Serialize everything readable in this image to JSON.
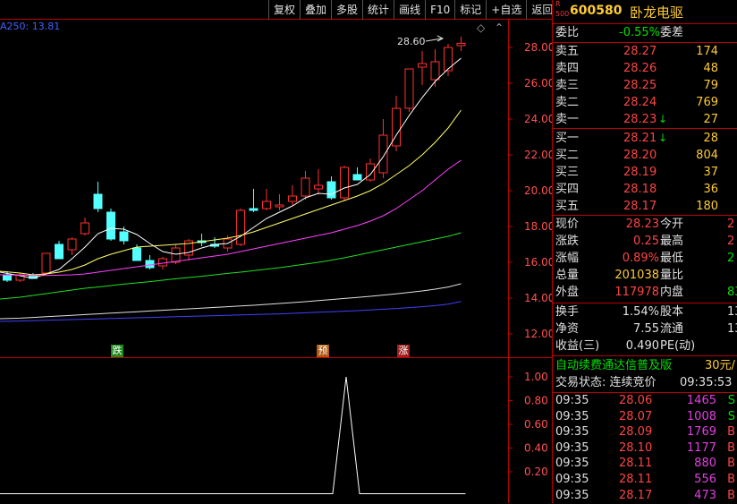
{
  "toolbar": [
    "复权",
    "叠加",
    "多股",
    "统计",
    "画线",
    "F10",
    "标记",
    "+自选",
    "返回"
  ],
  "ma_label": "A250: 13.81",
  "peak_label": "28.60",
  "markers": [
    {
      "text": "跌",
      "bg": "#1e8a1e",
      "color": "#fff"
    },
    {
      "text": "预",
      "bg": "#b05a10",
      "color": "#fff"
    },
    {
      "text": "涨",
      "bg": "#a02020",
      "color": "#fff"
    }
  ],
  "price_ticks": [
    "28.00",
    "26.00",
    "24.00",
    "22.00",
    "20.00",
    "18.00",
    "16.00",
    "14.00",
    "12.00"
  ],
  "ind_ticks": [
    "1.00",
    "0.80",
    "0.60",
    "0.40",
    "0.20"
  ],
  "chart_data": {
    "type": "candlestick",
    "ylim": [
      11.2,
      29.0
    ],
    "candles": [
      {
        "o": 15.3,
        "h": 15.5,
        "l": 14.9,
        "c": 15.0,
        "up": false
      },
      {
        "o": 15.0,
        "h": 15.4,
        "l": 14.9,
        "c": 15.3,
        "up": true
      },
      {
        "o": 15.3,
        "h": 15.4,
        "l": 15.1,
        "c": 15.1,
        "up": false
      },
      {
        "o": 15.4,
        "h": 16.3,
        "l": 15.3,
        "c": 16.5,
        "up": true
      },
      {
        "o": 17.0,
        "h": 17.2,
        "l": 16.2,
        "c": 16.2,
        "up": false
      },
      {
        "o": 16.7,
        "h": 17.4,
        "l": 16.4,
        "c": 17.3,
        "up": true
      },
      {
        "o": 17.6,
        "h": 18.5,
        "l": 17.5,
        "c": 18.2,
        "up": true
      },
      {
        "o": 19.8,
        "h": 20.5,
        "l": 18.8,
        "c": 19.0,
        "up": false
      },
      {
        "o": 18.8,
        "h": 19.0,
        "l": 17.2,
        "c": 17.3,
        "up": false
      },
      {
        "o": 17.7,
        "h": 18.0,
        "l": 17.0,
        "c": 17.2,
        "up": false
      },
      {
        "o": 16.8,
        "h": 17.0,
        "l": 16.1,
        "c": 16.1,
        "up": false
      },
      {
        "o": 16.1,
        "h": 16.4,
        "l": 15.6,
        "c": 15.7,
        "up": false
      },
      {
        "o": 15.8,
        "h": 16.3,
        "l": 15.6,
        "c": 16.2,
        "up": true
      },
      {
        "o": 16.0,
        "h": 17.0,
        "l": 15.9,
        "c": 16.8,
        "up": true
      },
      {
        "o": 16.4,
        "h": 17.3,
        "l": 16.1,
        "c": 17.2,
        "up": true
      },
      {
        "o": 17.2,
        "h": 17.6,
        "l": 16.9,
        "c": 17.1,
        "up": false
      },
      {
        "o": 17.0,
        "h": 17.4,
        "l": 16.8,
        "c": 16.9,
        "up": false
      },
      {
        "o": 16.8,
        "h": 17.5,
        "l": 16.6,
        "c": 17.3,
        "up": true
      },
      {
        "o": 17.0,
        "h": 19.0,
        "l": 16.9,
        "c": 18.9,
        "up": true
      },
      {
        "o": 19.0,
        "h": 20.1,
        "l": 18.8,
        "c": 18.9,
        "up": false
      },
      {
        "o": 19.0,
        "h": 20.1,
        "l": 18.9,
        "c": 19.4,
        "up": true
      },
      {
        "o": 19.1,
        "h": 19.8,
        "l": 18.9,
        "c": 19.2,
        "up": true
      },
      {
        "o": 19.4,
        "h": 20.3,
        "l": 19.2,
        "c": 19.7,
        "up": true
      },
      {
        "o": 19.7,
        "h": 21.1,
        "l": 19.5,
        "c": 20.7,
        "up": true
      },
      {
        "o": 20.3,
        "h": 21.2,
        "l": 19.8,
        "c": 20.1,
        "up": true
      },
      {
        "o": 20.5,
        "h": 20.8,
        "l": 19.5,
        "c": 19.6,
        "up": false
      },
      {
        "o": 19.6,
        "h": 21.4,
        "l": 19.4,
        "c": 21.3,
        "up": true
      },
      {
        "o": 20.9,
        "h": 21.3,
        "l": 20.6,
        "c": 20.6,
        "up": false
      },
      {
        "o": 20.6,
        "h": 21.8,
        "l": 20.5,
        "c": 21.5,
        "up": true
      },
      {
        "o": 21.0,
        "h": 24.0,
        "l": 20.7,
        "c": 23.1,
        "up": true
      },
      {
        "o": 22.5,
        "h": 25.3,
        "l": 22.2,
        "c": 24.6,
        "up": true
      },
      {
        "o": 24.6,
        "h": 26.8,
        "l": 24.4,
        "c": 26.8,
        "up": true
      },
      {
        "o": 26.9,
        "h": 27.8,
        "l": 25.9,
        "c": 27.1,
        "up": true
      },
      {
        "o": 26.2,
        "h": 27.9,
        "l": 25.8,
        "c": 27.2,
        "up": true
      },
      {
        "o": 26.7,
        "h": 28.2,
        "l": 26.4,
        "c": 28.0,
        "up": true
      },
      {
        "o": 28.1,
        "h": 28.6,
        "l": 27.8,
        "c": 28.23,
        "up": true
      }
    ],
    "ma": [
      {
        "name": "MA5",
        "color": "#ffffff",
        "values": [
          15.45,
          15.25,
          15.1,
          15.35,
          15.6,
          16.2,
          16.85,
          17.6,
          17.9,
          17.85,
          17.55,
          17.05,
          16.6,
          16.45,
          16.55,
          16.8,
          17.0,
          17.05,
          17.45,
          17.95,
          18.45,
          18.8,
          19.15,
          19.6,
          19.85,
          19.8,
          20.15,
          20.35,
          20.9,
          21.9,
          23.1,
          24.2,
          25.2,
          26.1,
          26.8,
          27.4
        ]
      },
      {
        "name": "MA10",
        "color": "#ffff66",
        "values": [
          15.5,
          15.4,
          15.3,
          15.35,
          15.45,
          15.6,
          15.85,
          16.2,
          16.45,
          16.65,
          16.85,
          16.9,
          16.95,
          17.0,
          17.05,
          17.15,
          17.25,
          17.35,
          17.5,
          17.7,
          17.95,
          18.2,
          18.45,
          18.7,
          18.95,
          19.2,
          19.45,
          19.7,
          20.0,
          20.4,
          20.9,
          21.4,
          22.0,
          22.7,
          23.5,
          24.5
        ]
      },
      {
        "name": "MA20",
        "color": "#ff40ff",
        "values": [
          15.3,
          15.28,
          15.26,
          15.26,
          15.28,
          15.3,
          15.35,
          15.45,
          15.55,
          15.65,
          15.75,
          15.85,
          15.95,
          16.05,
          16.15,
          16.25,
          16.35,
          16.45,
          16.6,
          16.75,
          16.9,
          17.05,
          17.2,
          17.35,
          17.5,
          17.65,
          17.85,
          18.05,
          18.3,
          18.6,
          19.0,
          19.5,
          20.0,
          20.6,
          21.2,
          21.7
        ]
      },
      {
        "name": "MA60",
        "color": "#20e020",
        "values": [
          13.95,
          14.05,
          14.15,
          14.25,
          14.35,
          14.45,
          14.55,
          14.62,
          14.7,
          14.78,
          14.85,
          14.92,
          15.0,
          15.08,
          15.15,
          15.22,
          15.3,
          15.38,
          15.45,
          15.53,
          15.62,
          15.7,
          15.8,
          15.9,
          16.0,
          16.12,
          16.25,
          16.4,
          16.55,
          16.7,
          16.85,
          17.0,
          17.15,
          17.3,
          17.45,
          17.65
        ]
      },
      {
        "name": "MA120",
        "color": "#e0e0e0",
        "values": [
          12.85,
          12.88,
          12.92,
          12.96,
          13.0,
          13.04,
          13.08,
          13.12,
          13.16,
          13.2,
          13.24,
          13.28,
          13.32,
          13.36,
          13.4,
          13.44,
          13.48,
          13.52,
          13.56,
          13.6,
          13.65,
          13.7,
          13.75,
          13.8,
          13.86,
          13.92,
          13.98,
          14.04,
          14.1,
          14.17,
          14.24,
          14.32,
          14.4,
          14.5,
          14.62,
          14.8
        ]
      },
      {
        "name": "MA250",
        "color": "#4040ff",
        "values": [
          12.7,
          12.72,
          12.74,
          12.76,
          12.78,
          12.8,
          12.82,
          12.84,
          12.86,
          12.88,
          12.9,
          12.92,
          12.94,
          12.96,
          12.98,
          13.0,
          13.02,
          13.04,
          13.06,
          13.08,
          13.1,
          13.12,
          13.15,
          13.18,
          13.21,
          13.24,
          13.27,
          13.3,
          13.34,
          13.38,
          13.42,
          13.47,
          13.52,
          13.58,
          13.66,
          13.81
        ]
      }
    ],
    "indicator": {
      "ylim": [
        0,
        1.1
      ],
      "values": [
        0,
        0,
        0,
        0,
        0,
        0,
        0,
        0,
        0,
        0,
        0,
        0,
        0,
        0,
        0,
        0,
        0,
        0,
        0,
        0,
        0,
        0,
        0,
        0,
        0,
        0,
        0,
        0,
        0,
        0,
        0,
        0,
        0,
        0,
        0,
        0
      ],
      "spike_index": 26,
      "spike_value": 1.0
    }
  },
  "quote": {
    "code": "600580",
    "name": "卧龙电驱",
    "market_r": "R",
    "market_n": "500",
    "weibi_label": "委比",
    "weibi": "-0.55%",
    "weicha_label": "委差",
    "asks": [
      {
        "label": "卖五",
        "price": "28.27",
        "vol": "174"
      },
      {
        "label": "卖四",
        "price": "28.26",
        "vol": "48"
      },
      {
        "label": "卖三",
        "price": "28.25",
        "vol": "79"
      },
      {
        "label": "卖二",
        "price": "28.24",
        "vol": "769"
      },
      {
        "label": "卖一",
        "price": "28.23",
        "vol": "27"
      }
    ],
    "bids": [
      {
        "label": "买一",
        "price": "28.21",
        "vol": "28"
      },
      {
        "label": "买二",
        "price": "28.20",
        "vol": "804"
      },
      {
        "label": "买三",
        "price": "28.19",
        "vol": "37"
      },
      {
        "label": "买四",
        "price": "28.18",
        "vol": "36"
      },
      {
        "label": "买五",
        "price": "28.17",
        "vol": "180"
      }
    ],
    "stats": [
      {
        "l1": "现价",
        "v1": "28.23",
        "c1": "red",
        "l2": "今开",
        "v2": "2",
        "c2": "red"
      },
      {
        "l1": "涨跌",
        "v1": "0.25",
        "c1": "red",
        "l2": "最高",
        "v2": "2",
        "c2": "red"
      },
      {
        "l1": "涨幅",
        "v1": "0.89%",
        "c1": "red",
        "l2": "最低",
        "v2": "2",
        "c2": "green"
      },
      {
        "l1": "总量",
        "v1": "201038",
        "c1": "yel",
        "l2": "量比",
        "v2": "",
        "c2": "yel"
      },
      {
        "l1": "外盘",
        "v1": "117978",
        "c1": "red",
        "l2": "内盘",
        "v2": "83",
        "c2": "green"
      }
    ],
    "stats2": [
      {
        "l1": "换手",
        "v1": "1.54%",
        "l2": "股本",
        "v2": "13"
      },
      {
        "l1": "净资",
        "v1": "7.55",
        "l2": "流通",
        "v2": "13"
      },
      {
        "l1": "收益(三)",
        "v1": "0.490",
        "l2": "PE(动)",
        "v2": ""
      }
    ],
    "ad_text": "自动续费通达信普及版",
    "ad_price": "30元/",
    "status_label": "交易状态: 连续竞价",
    "status_time": "09:35:53",
    "ticks": [
      {
        "time": "09:35",
        "price": "28.06",
        "vol": "1465",
        "side": "S"
      },
      {
        "time": "09:35",
        "price": "28.07",
        "vol": "1008",
        "side": "S"
      },
      {
        "time": "09:35",
        "price": "28.09",
        "vol": "1769",
        "side": "B"
      },
      {
        "time": "09:35",
        "price": "28.10",
        "vol": "1177",
        "side": "B"
      },
      {
        "time": "09:35",
        "price": "28.11",
        "vol": "880",
        "side": "B"
      },
      {
        "time": "09:35",
        "price": "28.11",
        "vol": "556",
        "side": "B"
      },
      {
        "time": "09:35",
        "price": "28.17",
        "vol": "473",
        "side": "B"
      }
    ]
  }
}
